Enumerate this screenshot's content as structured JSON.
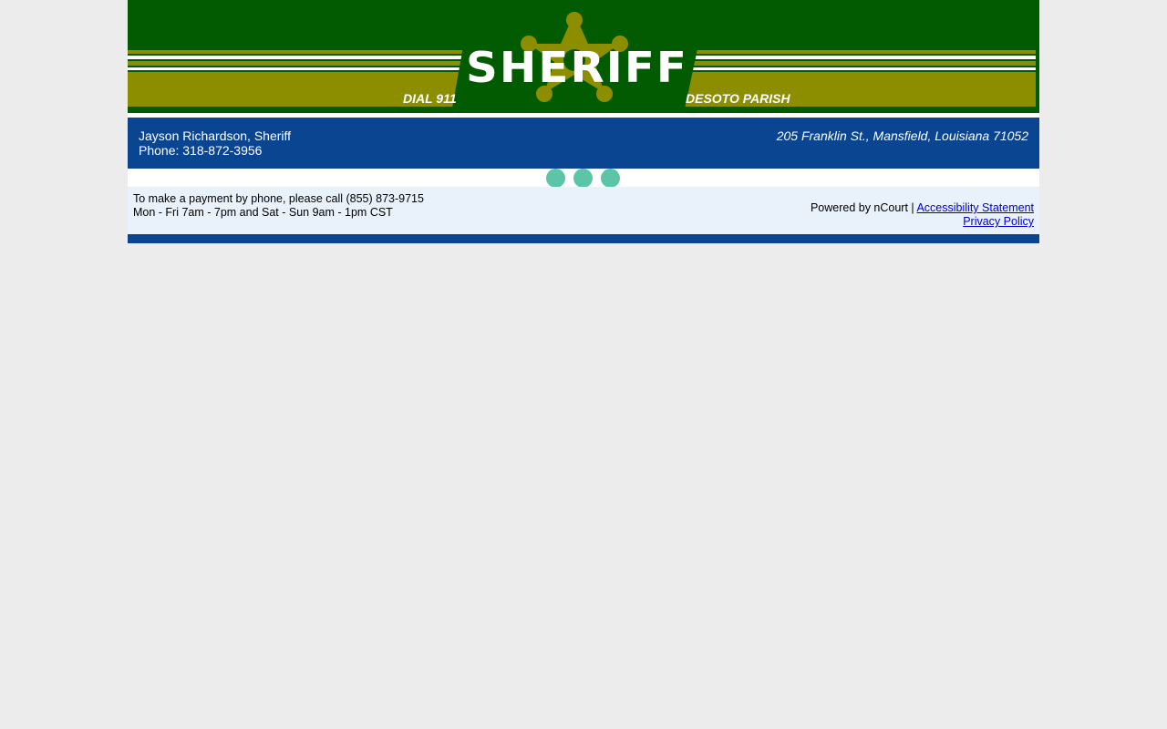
{
  "banner": {
    "title": "SHERIFF",
    "left_tag": "DIAL 911",
    "right_tag": "DESOTO PARISH",
    "colors": {
      "green": "#035b01",
      "olive": "#8c8e00",
      "star": "#8c8e00"
    }
  },
  "info": {
    "sheriff_name": "Jayson Richardson, Sheriff",
    "phone": "Phone: 318-872-3956",
    "address": "205 Franklin St., Mansfield, Louisiana 71052",
    "bg_color": "#0a4591"
  },
  "loader": {
    "icon": "loading-dots-icon",
    "color": "#5cc5a7"
  },
  "footer": {
    "payment_line1": "To make a payment by phone, please call (855) 873-9715",
    "payment_line2": "Mon - Fri 7am - 7pm and Sat - Sun 9am - 1pm CST",
    "powered_by": "Powered by nCourt |",
    "accessibility_link": "Accessibility Statement",
    "privacy_link": "Privacy Policy"
  }
}
